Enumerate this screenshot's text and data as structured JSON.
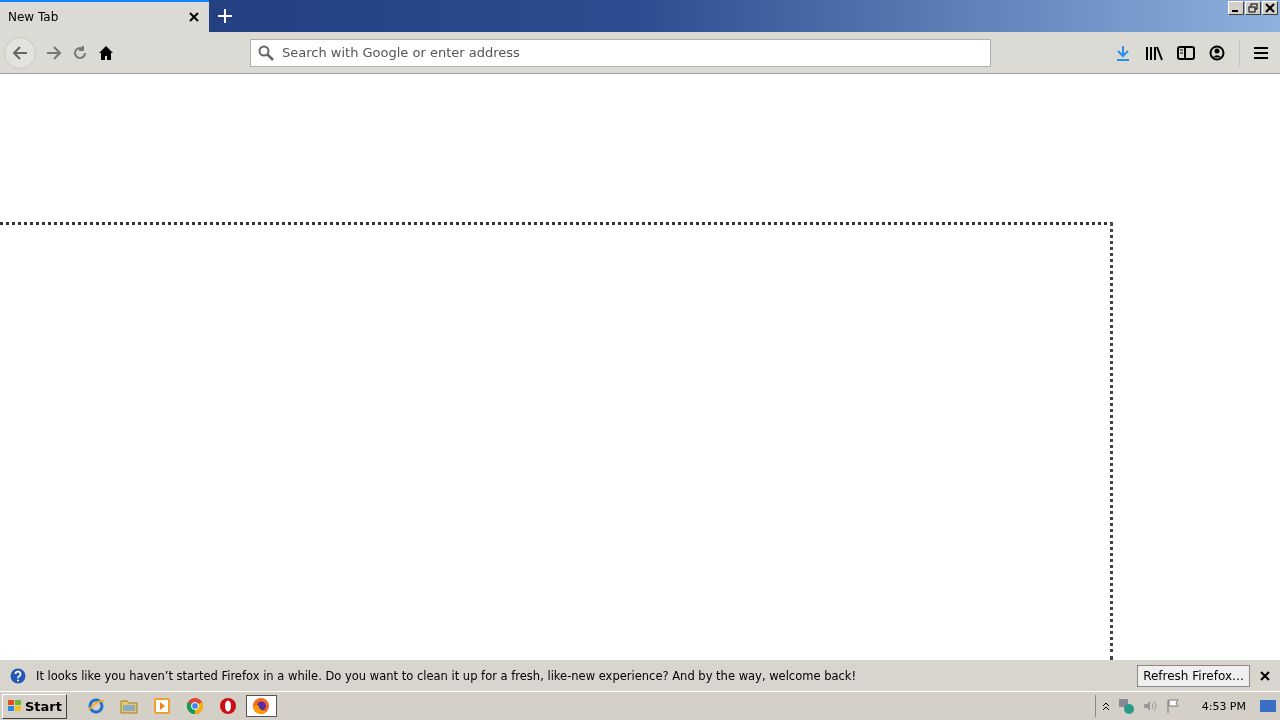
{
  "tabs": [
    {
      "label": "New Tab",
      "selected": true
    }
  ],
  "toolbar": {
    "address_placeholder": "Search with Google or enter address"
  },
  "notification": {
    "message": "It looks like you haven’t started Firefox in a while. Do you want to clean it up for a fresh, like-new experience? And by the way, welcome back!",
    "button": "Refresh Firefox…"
  },
  "taskbar": {
    "start": "Start",
    "apps": [
      {
        "kind": "ie",
        "selected": false
      },
      {
        "kind": "folder",
        "selected": false
      },
      {
        "kind": "media",
        "selected": false
      },
      {
        "kind": "chrome",
        "selected": false
      },
      {
        "kind": "opera",
        "selected": false
      },
      {
        "kind": "firefox",
        "selected": true
      }
    ],
    "clock": "4:53 PM"
  }
}
